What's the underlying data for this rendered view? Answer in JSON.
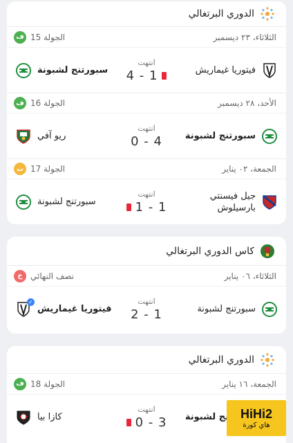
{
  "cards": [
    {
      "competition": "الدوري البرتغالي",
      "groups": [
        {
          "date": "الثلاثاء، ٢٣ ديسمبر",
          "round": "الجولة 15",
          "badge": "ف",
          "badge_color": "#4caf50",
          "match": {
            "home": "فيتوريا غيماريش",
            "away": "سبورتنج لشبونة",
            "status": "انتهت",
            "score": "4 - 1"
          }
        },
        {
          "date": "الأحد، ٢٨ ديسمبر",
          "round": "الجولة 16",
          "badge": "ف",
          "badge_color": "#4caf50",
          "match": {
            "home": "سبورتنج لشبونة",
            "away": "ريو آفي",
            "status": "انتهت",
            "score": "0 - 4"
          }
        },
        {
          "date": "الجمعة، ٠٢ يناير",
          "round": "الجولة 17",
          "badge": "ت",
          "badge_color": "#f6b73c",
          "match": {
            "home": "جيل فيسنتي بارسيلوش",
            "away": "سبورتنج لشبونة",
            "status": "انتهت",
            "score": "1 - 1"
          }
        }
      ]
    },
    {
      "competition": "كاس الدوري البرتغالي",
      "groups": [
        {
          "date": "الثلاثاء، ٠٦ يناير",
          "round": "نصف النهائي",
          "badge": "خ",
          "badge_color": "#f06a6a",
          "match": {
            "home": "سبورتنج لشبونة",
            "away": "فيتوريا غيماريش",
            "status": "انتهت",
            "score": "2 - 1"
          }
        }
      ]
    },
    {
      "competition": "الدوري البرتغالي",
      "groups": [
        {
          "date": "الجمعة، ١٦ يناير",
          "round": "الجولة 18",
          "badge": "ف",
          "badge_color": "#4caf50",
          "match": {
            "home": "سبورتنج لشبونة",
            "away": "كازا بيا",
            "status": "انتهت",
            "score": "0 - 3"
          }
        }
      ]
    }
  ],
  "watermark": {
    "main": "HiHi2",
    "sub": "هاي كورة"
  }
}
